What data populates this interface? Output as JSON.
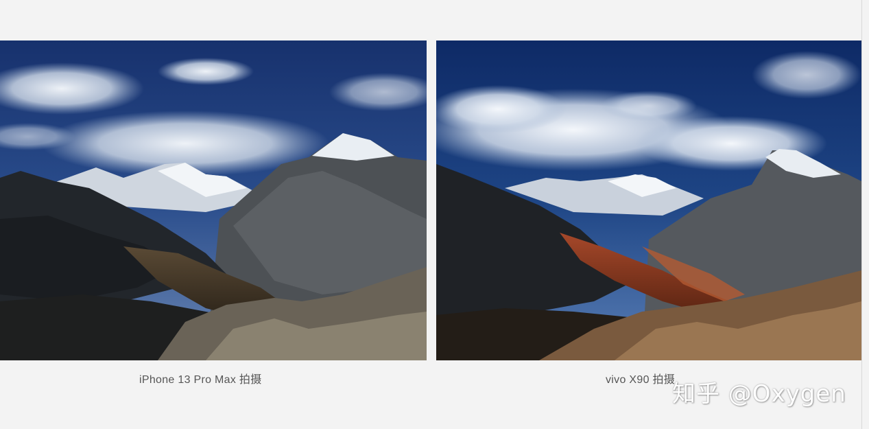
{
  "photos": [
    {
      "id": "left",
      "caption": "iPhone 13 Pro Max 拍摄"
    },
    {
      "id": "right",
      "caption": "vivo X90 拍摄"
    }
  ],
  "watermark": "知乎 @Oxygen",
  "colors": {
    "background": "#f3f3f3",
    "caption_text": "#555555",
    "sky_left_top": "#17316d",
    "sky_right_top": "#0e2a66",
    "valley_right": "#8a3a1c"
  }
}
